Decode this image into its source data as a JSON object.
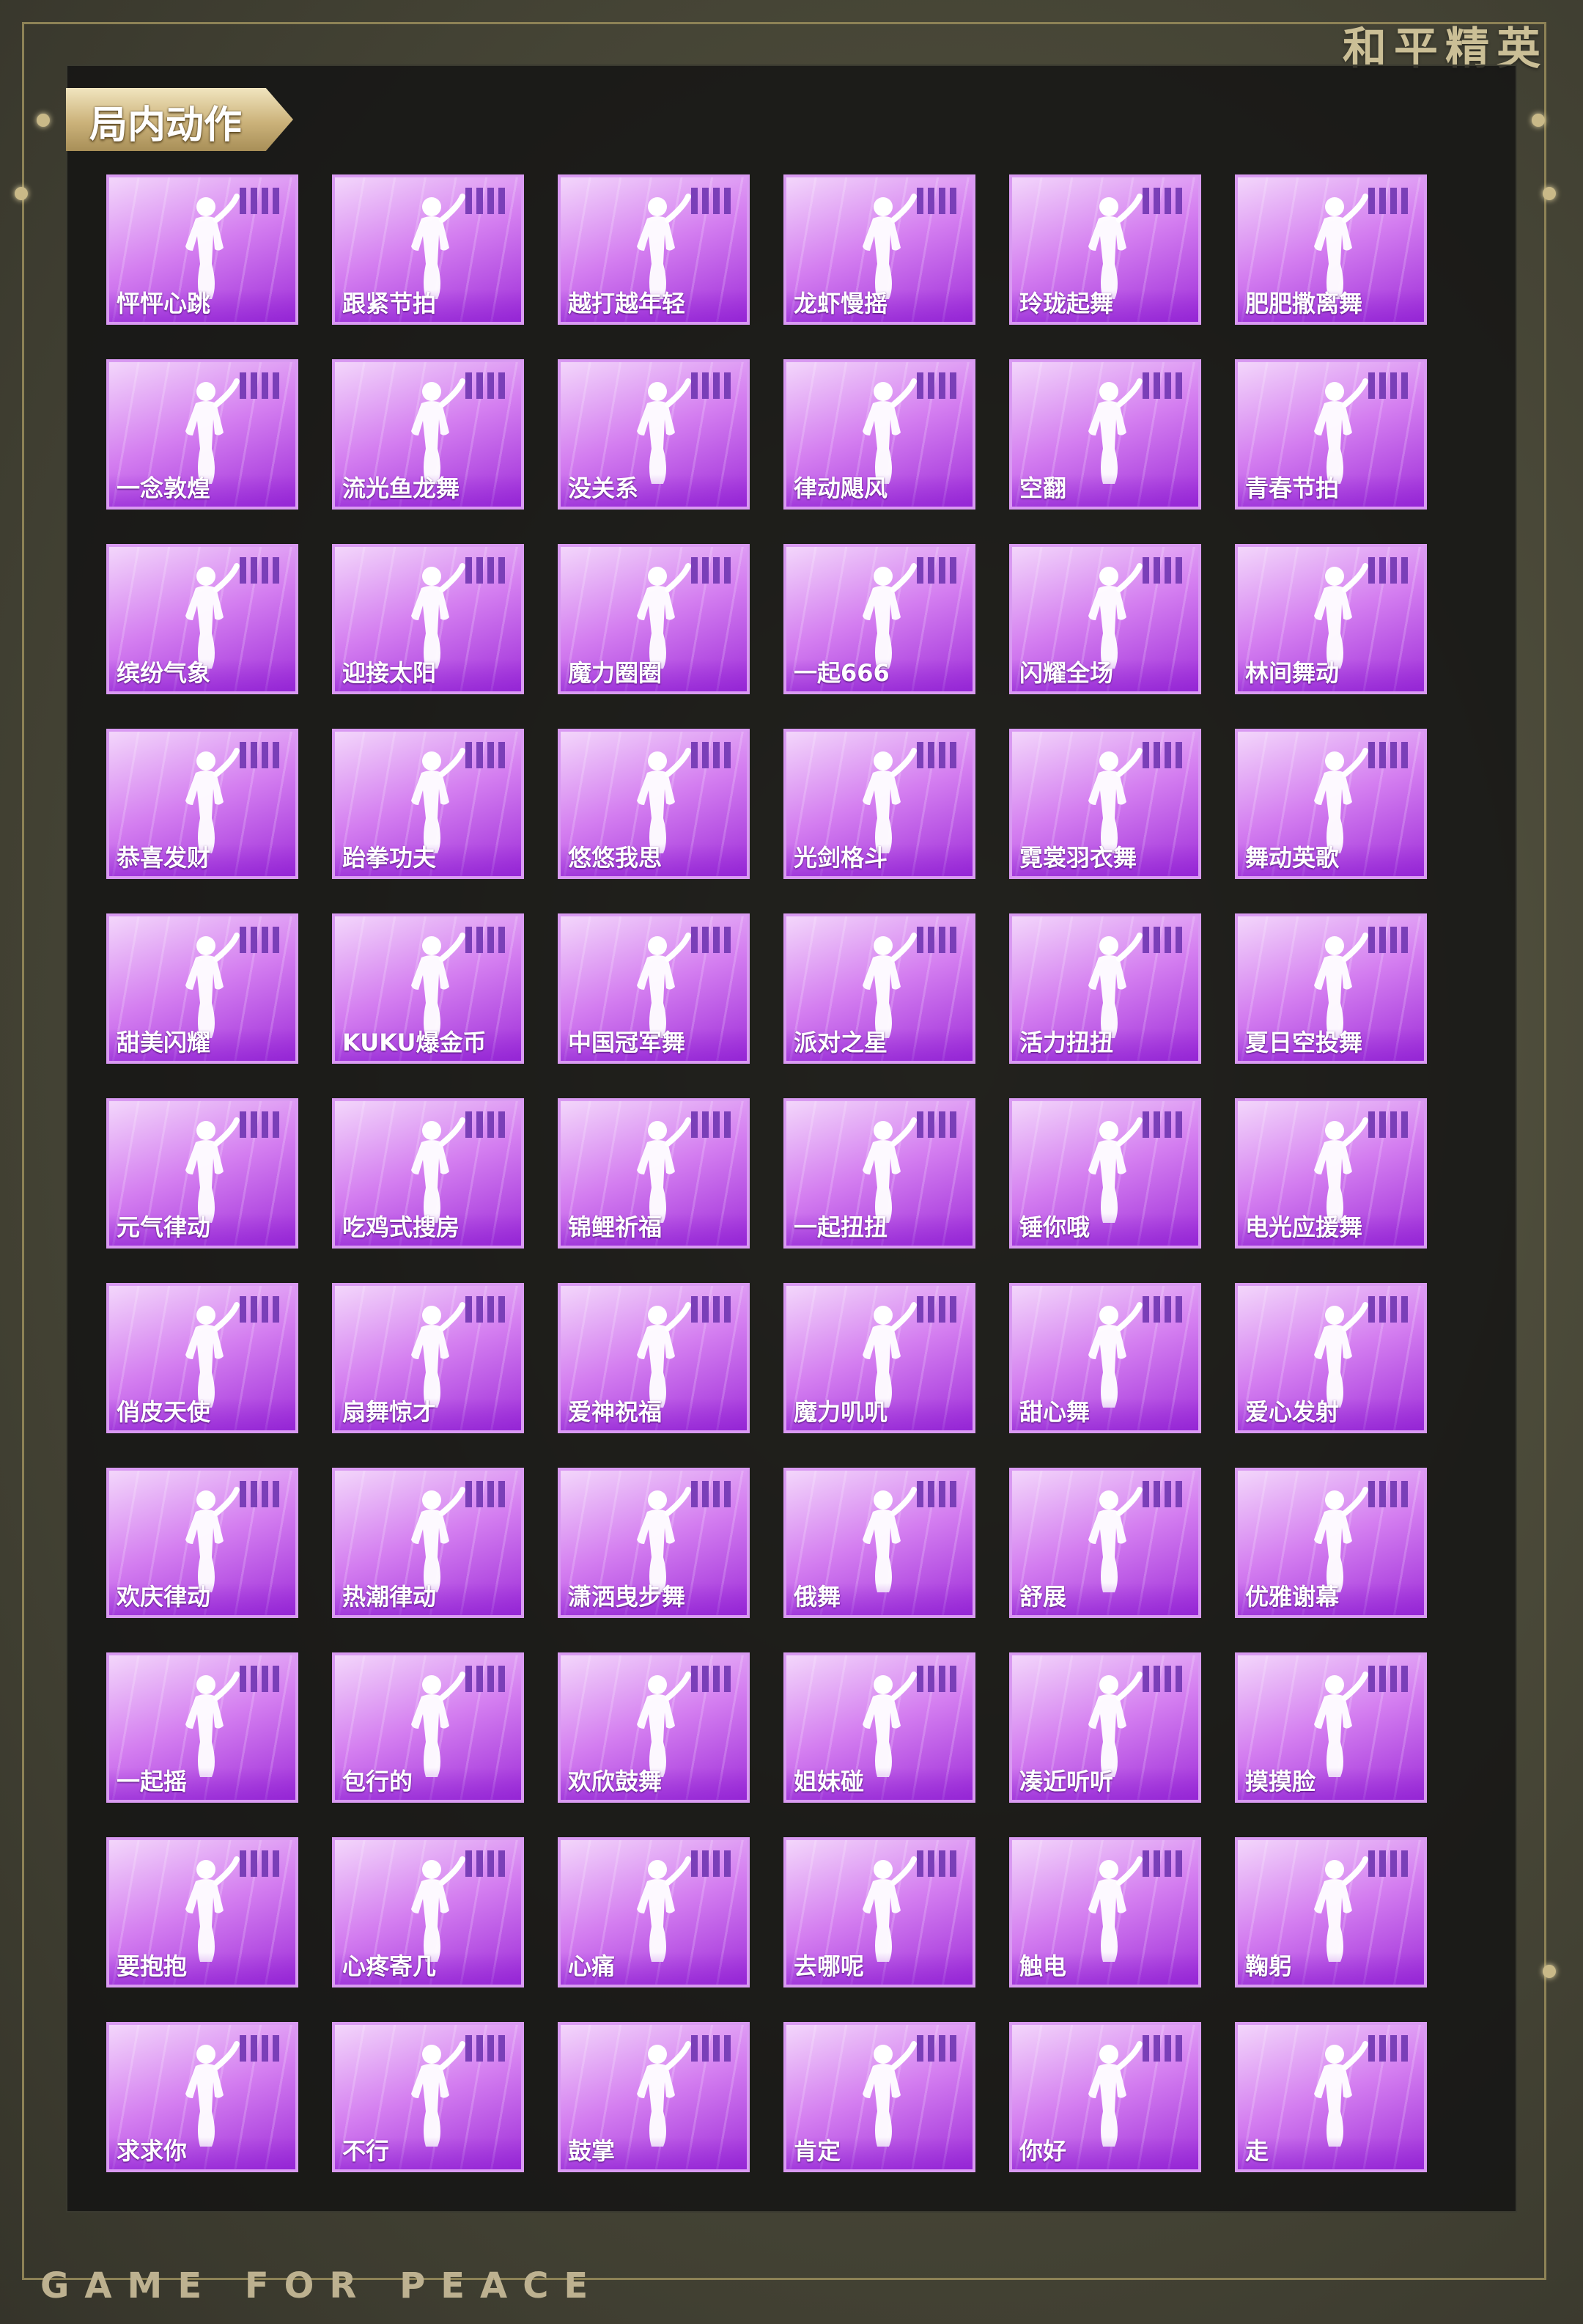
{
  "header": {
    "brand": "和平精英",
    "section_title": "局内动作"
  },
  "footer": {
    "slogan": "GAME FOR PEACE"
  },
  "emotes": [
    [
      "怦怦心跳",
      "跟紧节拍",
      "越打越年轻",
      "龙虾慢摇",
      "玲珑起舞",
      "肥肥撒离舞"
    ],
    [
      "一念敦煌",
      "流光鱼龙舞",
      "没关系",
      "律动飓风",
      "空翻",
      "青春节拍"
    ],
    [
      "缤纷气象",
      "迎接太阳",
      "魔力圈圈",
      "一起666",
      "闪耀全场",
      "林间舞动"
    ],
    [
      "恭喜发财",
      "跆拳功夫",
      "悠悠我思",
      "光剑格斗",
      "霓裳羽衣舞",
      "舞动英歌"
    ],
    [
      "甜美闪耀",
      "KUKU爆金币",
      "中国冠军舞",
      "派对之星",
      "活力扭扭",
      "夏日空投舞"
    ],
    [
      "元气律动",
      "吃鸡式搜房",
      "锦鲤祈福",
      "一起扭扭",
      "锤你哦",
      "电光应援舞"
    ],
    [
      "俏皮天使",
      "扇舞惊才",
      "爱神祝福",
      "魔力叽叽",
      "甜心舞",
      "爱心发射"
    ],
    [
      "欢庆律动",
      "热潮律动",
      "潇洒曳步舞",
      "俄舞",
      "舒展",
      "优雅谢幕"
    ],
    [
      "一起摇",
      "包行的",
      "欢欣鼓舞",
      "姐妹碰",
      "凑近听听",
      "摸摸脸"
    ],
    [
      "要抱抱",
      "心疼寄几",
      "心痛",
      "去哪呢",
      "触电",
      "鞠躬"
    ],
    [
      "求求你",
      "不行",
      "鼓掌",
      "肯定",
      "你好",
      "走"
    ]
  ]
}
